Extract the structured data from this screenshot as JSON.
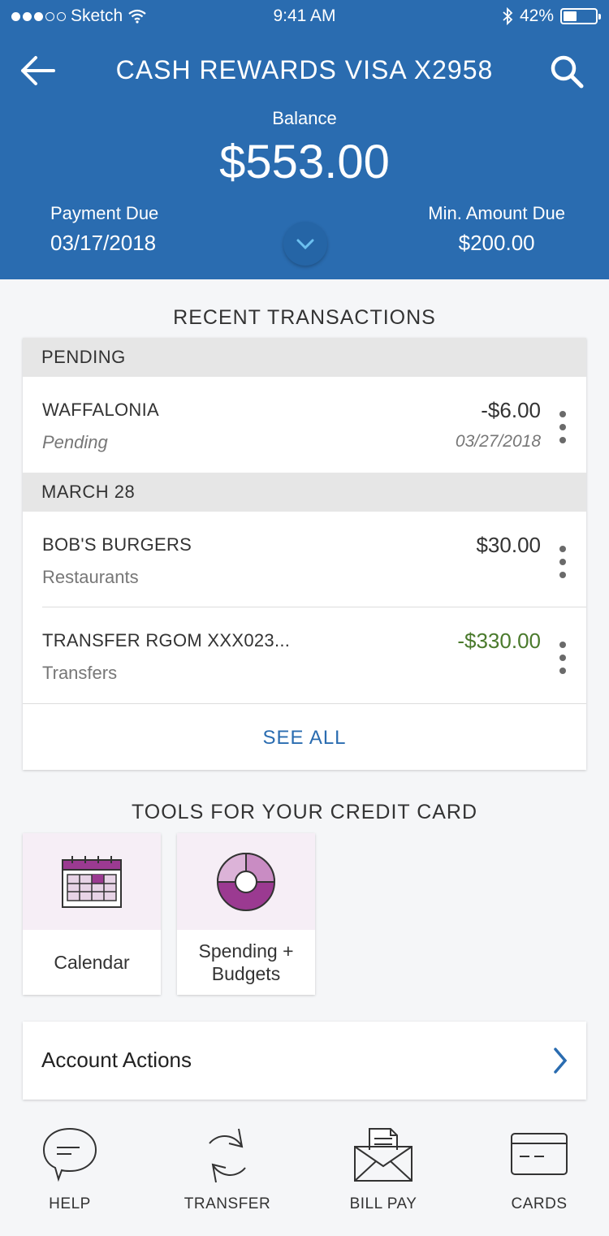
{
  "status_bar": {
    "carrier": "Sketch",
    "time": "9:41 AM",
    "battery": "42%"
  },
  "header": {
    "title": "CASH REWARDS VISA X2958",
    "balance_label": "Balance",
    "balance_value": "$553.00",
    "payment_due_label": "Payment Due",
    "payment_due_value": "03/17/2018",
    "min_due_label": "Min. Amount Due",
    "min_due_value": "$200.00"
  },
  "transactions": {
    "title": "RECENT TRANSACTIONS",
    "groups": [
      {
        "header": "PENDING",
        "items": [
          {
            "name": "WAFFALONIA",
            "sub": "Pending",
            "amount": "-$6.00",
            "date": "03/27/2018"
          }
        ]
      },
      {
        "header": "MARCH 28",
        "items": [
          {
            "name": "BOB'S BURGERS",
            "sub": "Restaurants",
            "amount": "$30.00"
          },
          {
            "name": "TRANSFER RGOM XXX023...",
            "sub": "Transfers",
            "amount": "-$330.00"
          }
        ]
      }
    ],
    "see_all": "SEE ALL"
  },
  "tools": {
    "title": "TOOLS FOR YOUR CREDIT CARD",
    "items": [
      {
        "label": "Calendar"
      },
      {
        "label": "Spending +\nBudgets"
      }
    ]
  },
  "account_actions": {
    "label": "Account Actions"
  },
  "nav": {
    "items": [
      {
        "label": "HELP"
      },
      {
        "label": "TRANSFER"
      },
      {
        "label": "BILL PAY"
      },
      {
        "label": "CARDS"
      }
    ]
  },
  "colors": {
    "brand": "#2a6cb0",
    "positive": "#4a7a2c",
    "tool_accent": "#9b3a91"
  }
}
